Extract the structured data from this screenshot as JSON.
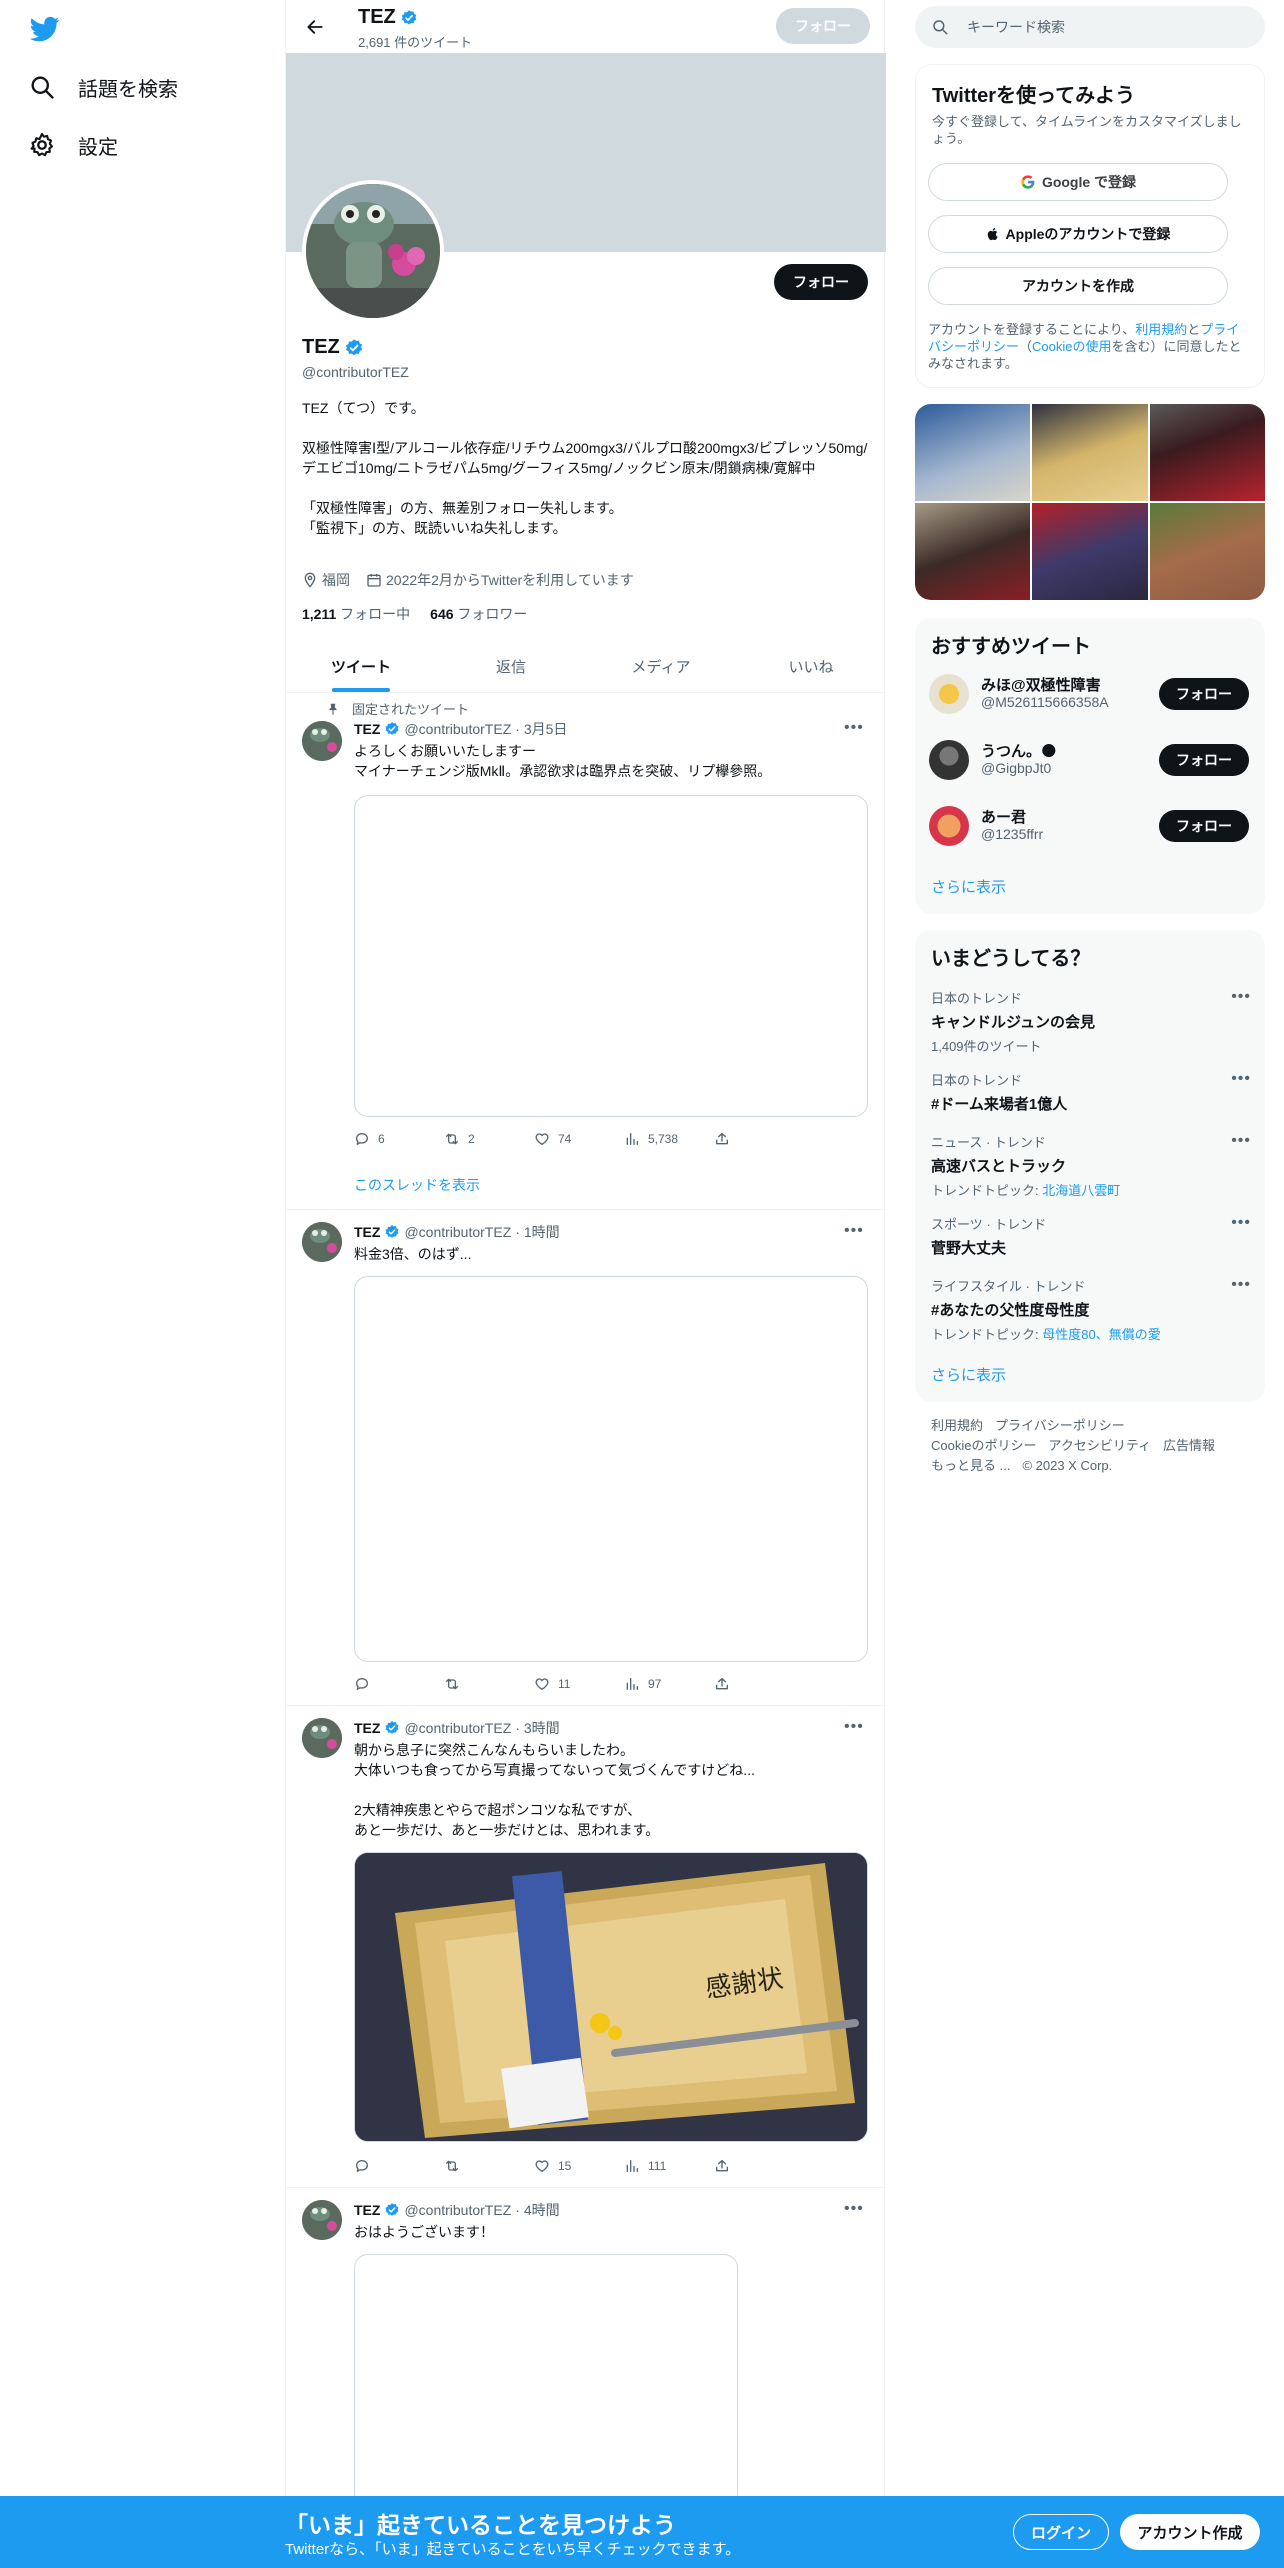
{
  "nav": {
    "items": [
      {
        "label": "話題を検索",
        "icon": "search-icon"
      },
      {
        "label": "設定",
        "icon": "gear-icon"
      }
    ]
  },
  "header": {
    "name": "TEZ",
    "tweet_count": "2,691 件のツイート",
    "follow_label": "フォロー"
  },
  "profile": {
    "name": "TEZ",
    "handle": "@contributorTEZ",
    "follow_label": "フォロー",
    "bio": "TEZ（てつ）です。\n\n双極性障害Ⅰ型/アルコール依存症/リチウム200mgx3/バルプロ酸200mgx3/ビプレッソ50mg/デエビゴ10mg/ニトラゼパム5mg/グーフィス5mg/ノックビン原末/閉鎖病棟/寛解中\n\n「双極性障害」の方、無差別フォロー失礼します。\n「監視下」の方、既読いいね失礼します。",
    "location": "福岡",
    "joined": "2022年2月からTwitterを利用しています",
    "following_count": "1,211",
    "following_label": "フォロー中",
    "followers_count": "646",
    "followers_label": "フォロワー"
  },
  "tabs": [
    "ツイート",
    "返信",
    "メディア",
    "いいね"
  ],
  "tweets": [
    {
      "pinned_label": "固定されたツイート",
      "name": "TEZ",
      "handle": "@contributorTEZ",
      "time": "· 3月5日",
      "text": "よろしくお願いいたしますー\nマイナーチェンジ版MkⅡ。承認欲求は臨界点を突破、リプ欅參照。",
      "replies": "6",
      "retweets": "2",
      "likes": "74",
      "views": "5,738",
      "thread_label": "このスレッドを表示"
    },
    {
      "name": "TEZ",
      "handle": "@contributorTEZ",
      "time": "· 1時間",
      "text": "料金3倍、のはず...",
      "replies": "",
      "retweets": "",
      "likes": "11",
      "views": "97"
    },
    {
      "name": "TEZ",
      "handle": "@contributorTEZ",
      "time": "· 3時間",
      "text": "朝から息子に突然こんなんもらいましたわ。\n大体いつも食ってから写真撮ってないって気づくんですけどね...\n\n2大精神疾患とやらで超ポンコツな私ですが、\nあと一歩だけ、あと一歩だけとは、思われます。",
      "image_text": "感謝状",
      "replies": "",
      "retweets": "",
      "likes": "15",
      "views": "111"
    },
    {
      "name": "TEZ",
      "handle": "@contributorTEZ",
      "time": "· 4時間",
      "text": "おはようございます！"
    }
  ],
  "right": {
    "search_placeholder": "キーワード検索",
    "signup": {
      "title": "Twitterを使ってみよう",
      "subtitle": "今すぐ登録して、タイムラインをカスタマイズしましょう。",
      "google": "Google で登録",
      "apple": "Appleのアカウントで登録",
      "create": "アカウントを作成",
      "legal_1": "アカウントを登録することにより、",
      "legal_terms": "利用規約",
      "legal_2": "と",
      "legal_privacy": "プライバシーポリシー",
      "legal_3": "（",
      "legal_cookie": "Cookieの使用",
      "legal_4": "を含む）に同意したとみなされます。"
    },
    "recommend": {
      "title": "おすすめツイート",
      "users": [
        {
          "name": "みほ@双極性障害",
          "handle": "@M526115666358A",
          "follow": "フォロー"
        },
        {
          "name": "うつん。🌑",
          "handle": "@GigbpJt0",
          "follow": "フォロー"
        },
        {
          "name": "あー君",
          "handle": "@1235ffrr",
          "follow": "フォロー"
        }
      ],
      "more": "さらに表示"
    },
    "trends": {
      "title": "いまどうしてる？",
      "items": [
        {
          "context": "日本のトレンド",
          "title": "キャンドルジュンの会見",
          "extra": "1,409件のツイート",
          "extra_hl": ""
        },
        {
          "context": "日本のトレンド",
          "title": "#ドーム来場者1億人",
          "extra": "",
          "extra_hl": ""
        },
        {
          "context": "ニュース · トレンド",
          "title": "高速バスとトラック",
          "extra": "トレンドトピック: ",
          "extra_hl": "北海道八雲町"
        },
        {
          "context": "スポーツ · トレンド",
          "title": "菅野大丈夫",
          "extra": "",
          "extra_hl": ""
        },
        {
          "context": "ライフスタイル · トレンド",
          "title": "#あなたの父性度母性度",
          "extra": "トレンドトピック: ",
          "extra_hl": "母性度80、無償の愛"
        }
      ],
      "more": "さらに表示"
    },
    "footer": {
      "links": [
        "利用規約",
        "プライバシーポリシー",
        "Cookieのポリシー",
        "アクセシビリティ",
        "広告情報",
        "もっと見る ...",
        "© 2023 X Corp."
      ]
    }
  },
  "bottom": {
    "title": "「いま」起きていることを見つけよう",
    "subtitle": "Twitterなら、「いま」起きていることをいち早くチェックできます。",
    "login": "ログイン",
    "create": "アカウント作成"
  },
  "colors": {
    "accent": "#1d9bf0",
    "text": "#0f1419",
    "muted": "#536471"
  }
}
